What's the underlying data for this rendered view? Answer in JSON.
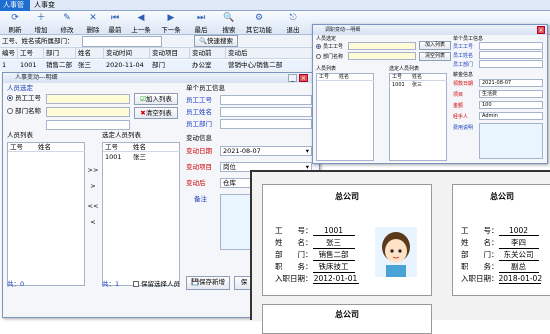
{
  "tabs": [
    "人事管理",
    "人事变动"
  ],
  "toolbar": [
    {
      "label": "刷新",
      "icon": "refresh-icon",
      "glyph": "⟳"
    },
    {
      "label": "增加",
      "icon": "add-icon",
      "glyph": "＋"
    },
    {
      "label": "修改",
      "icon": "edit-icon",
      "glyph": "✎"
    },
    {
      "label": "删除",
      "icon": "delete-icon",
      "glyph": "✕"
    },
    {
      "label": "最前",
      "icon": "first-icon",
      "glyph": "⏮"
    },
    {
      "label": "上一条",
      "icon": "prev-icon",
      "glyph": "◀"
    },
    {
      "label": "下一条",
      "icon": "next-icon",
      "glyph": "▶"
    },
    {
      "label": "最后",
      "icon": "last-icon",
      "glyph": "⏭"
    },
    {
      "label": "搜索",
      "icon": "search-icon",
      "glyph": "🔍"
    },
    {
      "label": "其它功能",
      "icon": "more-icon",
      "glyph": "⚙"
    },
    {
      "label": "退出",
      "icon": "exit-icon",
      "glyph": "⎋"
    }
  ],
  "search": {
    "label": "工号、姓名或所属部门：",
    "button": "快速搜索"
  },
  "grid": {
    "headers": [
      "编号",
      "工号",
      "部门",
      "姓名",
      "变动时间",
      "变动项目",
      "变动前",
      "变动后"
    ],
    "row": [
      "1",
      "1001",
      "销售二部",
      "张三",
      "2020-11-04",
      "部门",
      "办公室",
      "营销中心/销售二部"
    ]
  },
  "dialog": {
    "title": "人事变动---明细",
    "group_person": "人员选定",
    "radio_id": "员工工号",
    "radio_dept": "部门名称",
    "btn_add": "加入列表",
    "btn_clear": "清空列表",
    "single_info": "单个员工信息",
    "info_id": "员工工号",
    "info_name": "员工姓名",
    "info_dept": "员工部门",
    "list_label": "人员列表",
    "selected_label": "选定人员列表",
    "col_id": "工号",
    "col_name": "姓名",
    "selected_rows": [
      {
        "id": "1001",
        "name": "张三"
      }
    ],
    "arrows": [
      ">>",
      ">",
      "<<",
      "<"
    ],
    "change_info": "变动信息",
    "date_label": "变动日期",
    "date_value": "2021-08-07",
    "item_label": "变动项目",
    "item_value": "岗位",
    "after_label": "变动后",
    "after_value": "仓库",
    "note_label": "备注",
    "count_left": "共：0",
    "count_right": "共：1",
    "keep_label": "保留选择人员",
    "save_new": "保存新增",
    "save": "保"
  },
  "dialog2": {
    "title": "调职变动---明细",
    "group_person": "人员选定",
    "radio_id": "员工工号",
    "radio_dept": "部门名称",
    "btn_add": "加入列表",
    "btn_clear": "清空列表",
    "single_info": "单个员工信息",
    "info_id": "员工工号",
    "info_name": "员工姓名",
    "info_dept": "员工部门",
    "list_label": "人员列表",
    "selected_label": "选定人员列表",
    "col_id": "工号",
    "col_name": "姓名",
    "selected_rows": [
      {
        "id": "1001",
        "name": "张三"
      }
    ],
    "change_info": "薪金信息",
    "date_label": "领款日期",
    "date_value": "2021-08-07",
    "item_label": "项目",
    "item_value": "生活费",
    "amount_label": "金额",
    "amount_value": "100",
    "handler_label": "经手人",
    "handler_value": "Admin",
    "note_label": "费用说明"
  },
  "cards": [
    {
      "company": "总公司",
      "id": "1001",
      "name": "张三",
      "dept": "销售二部",
      "post": "铁床技工",
      "date": "2012-01-01"
    },
    {
      "company": "总公司",
      "id": "1002",
      "name": "李四",
      "dept": "东关公司",
      "post": "副总",
      "date": "2018-01-02"
    },
    {
      "company": "总公司"
    }
  ],
  "card_labels": {
    "id": "工　　号：",
    "name": "姓　　名：",
    "dept": "部　　门：",
    "post": "职　　务：",
    "date": "入职日期："
  }
}
